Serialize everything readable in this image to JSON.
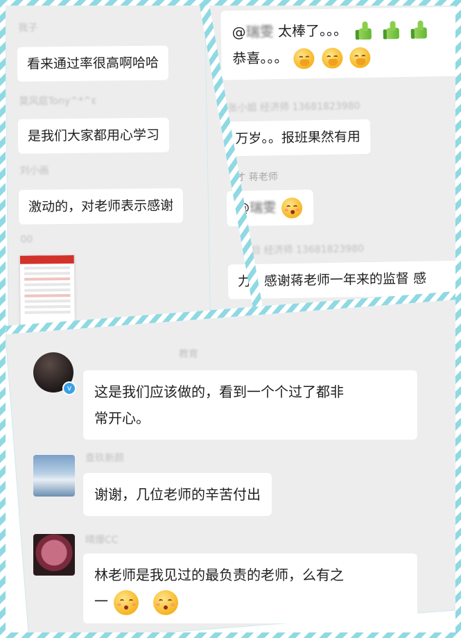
{
  "colors": {
    "frame": "#8fd9e3",
    "panel_bg": "#ededed",
    "bubble_bg": "#ffffff",
    "verified": "#3aa0e8"
  },
  "left_panel": {
    "messages": [
      {
        "name": "我子",
        "text": "看来通过率很高啊哈哈"
      },
      {
        "name": "莫风庭Tony^*^ɛ",
        "text": "是我们大家都用心学习"
      },
      {
        "name": "刘小画",
        "text": "激动的，对老师表示感谢"
      },
      {
        "name": "00",
        "attachment": "image"
      }
    ]
  },
  "right_panel": {
    "messages": [
      {
        "text_prefix": "@",
        "mention": "瑞雯",
        "text": "太棒了。。。",
        "icons": [
          "thumbs-up-icon",
          "thumbs-up-icon",
          "thumbs-up-icon"
        ]
      },
      {
        "text": "恭喜。。。",
        "icons": [
          "hugging-face-emoji",
          "hugging-face-emoji",
          "hugging-face-emoji"
        ]
      },
      {
        "name": "张小姐 经济师 13681823980",
        "text": "万岁。。报班果然有用"
      },
      {
        "name": "才 蒋老师",
        "text_prefix": "@",
        "mention": "瑞雯",
        "icons": [
          "kissing-face-emoji"
        ]
      },
      {
        "name": "目 经济师 13681823980",
        "text": "力。感谢蒋老师一年来的监督 感"
      }
    ]
  },
  "bottom_panel": {
    "top_name": "教育",
    "messages": [
      {
        "name": "",
        "verified": true,
        "text_line1": "这是我们应该做的，看到一个个过了都非",
        "text_line2": "常开心。"
      },
      {
        "name": "查玖新颜",
        "text": "谢谢，几位老师的辛苦付出"
      },
      {
        "name": "晴爆CC",
        "text_line1": "林老师是我见过的最负责的老师，么有之",
        "text_line2": "一",
        "icons": [
          "kissing-face-emoji",
          "kissing-face-emoji"
        ]
      }
    ]
  }
}
